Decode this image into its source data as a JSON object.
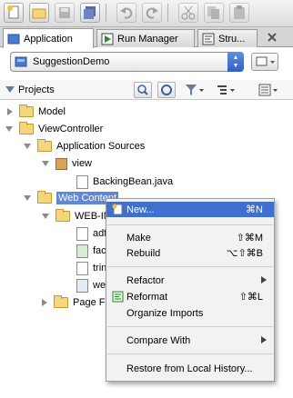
{
  "tabs": [
    {
      "label": "Application",
      "icon": "application-navigator-icon"
    },
    {
      "label": "Run Manager",
      "icon": "run-manager-icon"
    },
    {
      "label": "Stru...",
      "icon": "structure-icon"
    }
  ],
  "application": {
    "selected": "SuggestionDemo"
  },
  "projects_panel": {
    "title": "Projects"
  },
  "tree": {
    "model": "Model",
    "view_controller": "ViewController",
    "application_sources": "Application Sources",
    "view": "view",
    "backing_bean": "BackingBean.java",
    "web_content": "Web Content",
    "web_inf": "WEB-IN",
    "item_adf": "adf",
    "item_fac": "fac",
    "item_trin": "trin",
    "item_we": "we",
    "page_flows": "Page Fl"
  },
  "context_menu": {
    "new": {
      "label": "New...",
      "shortcut": "⌘N"
    },
    "make": {
      "label": "Make",
      "shortcut": "⇧⌘M"
    },
    "rebuild": {
      "label": "Rebuild",
      "shortcut": "⌥⇧⌘B"
    },
    "refactor": {
      "label": "Refactor"
    },
    "reformat": {
      "label": "Reformat",
      "shortcut": "⇧⌘L"
    },
    "organize_imports": {
      "label": "Organize Imports"
    },
    "compare_with": {
      "label": "Compare With"
    },
    "restore": {
      "label": "Restore from Local History..."
    }
  },
  "colors": {
    "selection": "#5f87d6",
    "menu_highlight": "#3f6fd1"
  }
}
